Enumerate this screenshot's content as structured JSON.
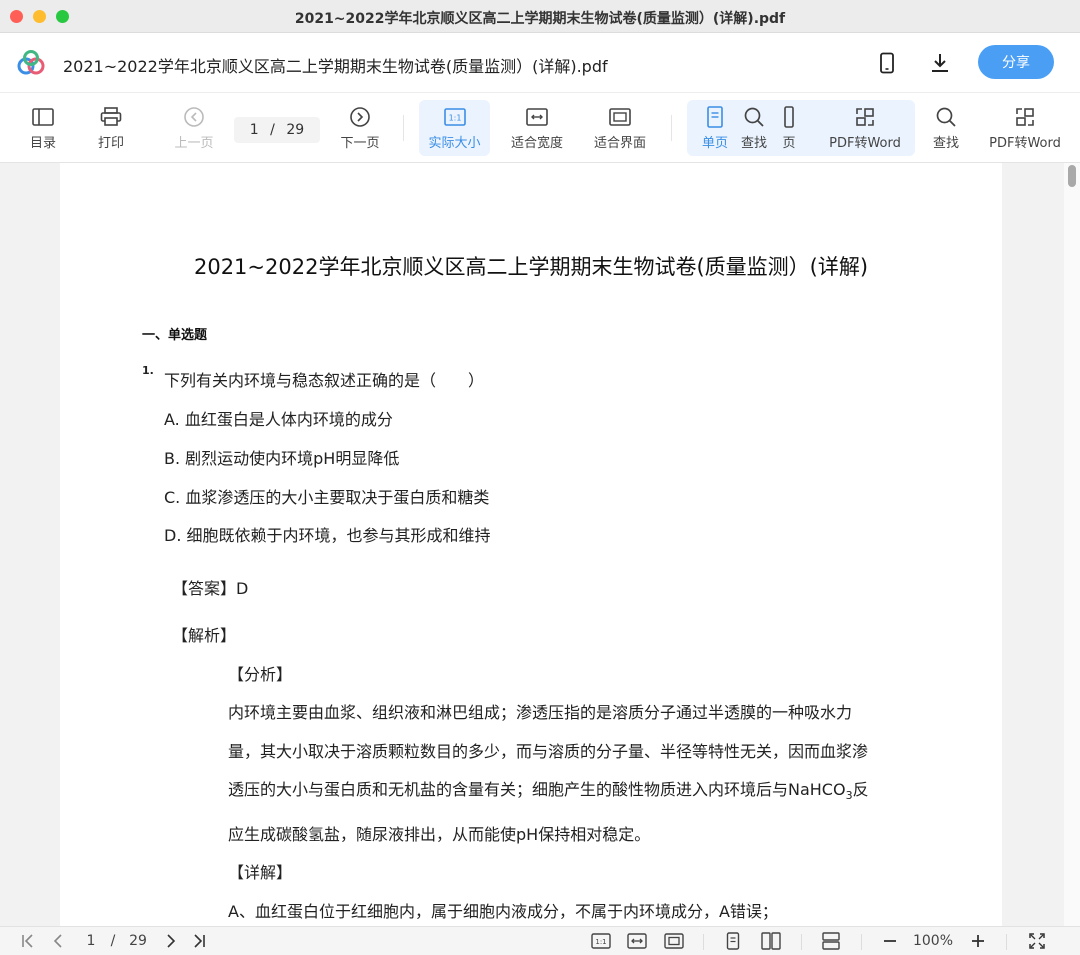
{
  "window": {
    "title": "2021~2022学年北京顺义区高二上学期期末生物试卷(质量监测）(详解).pdf"
  },
  "header": {
    "doc_name": "2021~2022学年北京顺义区高二上学期期末生物试卷(质量监测）(详解).pdf",
    "share_label": "分享",
    "icons": [
      "logo-icon",
      "phone-icon",
      "download-icon"
    ]
  },
  "toolbar": {
    "toc": "目录",
    "print": "打印",
    "prev": "上一页",
    "page_current": "1",
    "page_sep": "/",
    "page_total": "29",
    "next": "下一页",
    "actual_size": "实际大小",
    "fit_width": "适合宽度",
    "fit_page": "适合界面",
    "single_page": "单页",
    "find": "查找",
    "page_short": "页",
    "pdf_to_word": "PDF转Word",
    "find2": "查找",
    "pdf_to_word2": "PDF转Word"
  },
  "document": {
    "title": "2021~2022学年北京顺义区高二上学期期末生物试卷(质量监测）(详解)",
    "section": "一、单选题",
    "q_number": "1.",
    "question": "下列有关内环境与稳态叙述正确的是（　　）",
    "options": [
      "A. 血红蛋白是人体内环境的成分",
      "B. 剧烈运动使内环境pH明显降低",
      "C. 血浆渗透压的大小主要取决于蛋白质和糖类",
      "D. 细胞既依赖于内环境，也参与其形成和维持"
    ],
    "answer_label": "【答案】",
    "answer_value": "D",
    "analysis_label": "【解析】",
    "fenxi_label": "【分析】",
    "para1": "内环境主要由血浆、组织液和淋巴组成；渗透压指的是溶质分子通过半透膜的一种吸水力",
    "para2": "量，其大小取决于溶质颗粒数目的多少，而与溶质的分子量、半径等特性无关，因而血浆渗",
    "para3_a": "透压的大小与蛋白质和无机盐的含量有关；细胞产生的酸性物质进入内环境后与NaHCO",
    "para3_sub": "3",
    "para3_b": "反",
    "para4": "应生成碳酸氢盐，随尿液排出，从而能使pH保持相对稳定。",
    "detail_label": "【详解】",
    "para5": "A、血红蛋白位于红细胞内，属于细胞内液成分，不属于内环境成分，A错误；"
  },
  "statusbar": {
    "page_current": "1",
    "page_sep": "/",
    "page_total": "29",
    "zoom": "100%"
  },
  "colors": {
    "accent": "#4a9ff5",
    "active_bg": "#eaf3fe",
    "active_text": "#3a8ee6"
  }
}
